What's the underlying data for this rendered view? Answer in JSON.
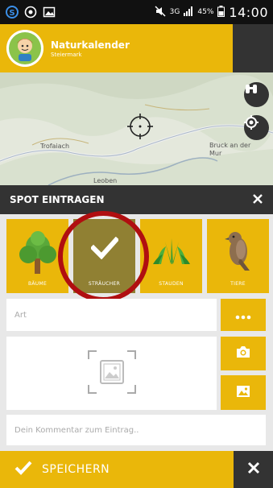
{
  "status_bar": {
    "battery": "45%",
    "network": "3G",
    "time": "14:00"
  },
  "app": {
    "title": "Naturkalender",
    "subtitle": "Steiermark"
  },
  "map": {
    "places": [
      "Trofaiach",
      "Bruck an der Mur",
      "Leoben"
    ]
  },
  "spot": {
    "title": "SPOT EINTRAGEN",
    "categories": [
      {
        "label": "BÄUME",
        "icon": "tree-icon",
        "selected": false
      },
      {
        "label": "STRÄUCHER",
        "icon": "checkmark-icon",
        "selected": true
      },
      {
        "label": "STAUDEN",
        "icon": "plant-icon",
        "selected": false
      },
      {
        "label": "TIERE",
        "icon": "bird-icon",
        "selected": false
      }
    ],
    "art_placeholder": "Art",
    "comment_placeholder": "Dein Kommentar zum Eintrag..",
    "save_label": "SPEICHERN"
  },
  "colors": {
    "accent": "#eab70a",
    "dark": "#333333",
    "selected": "#908033",
    "highlight_ring": "#b00e10"
  }
}
